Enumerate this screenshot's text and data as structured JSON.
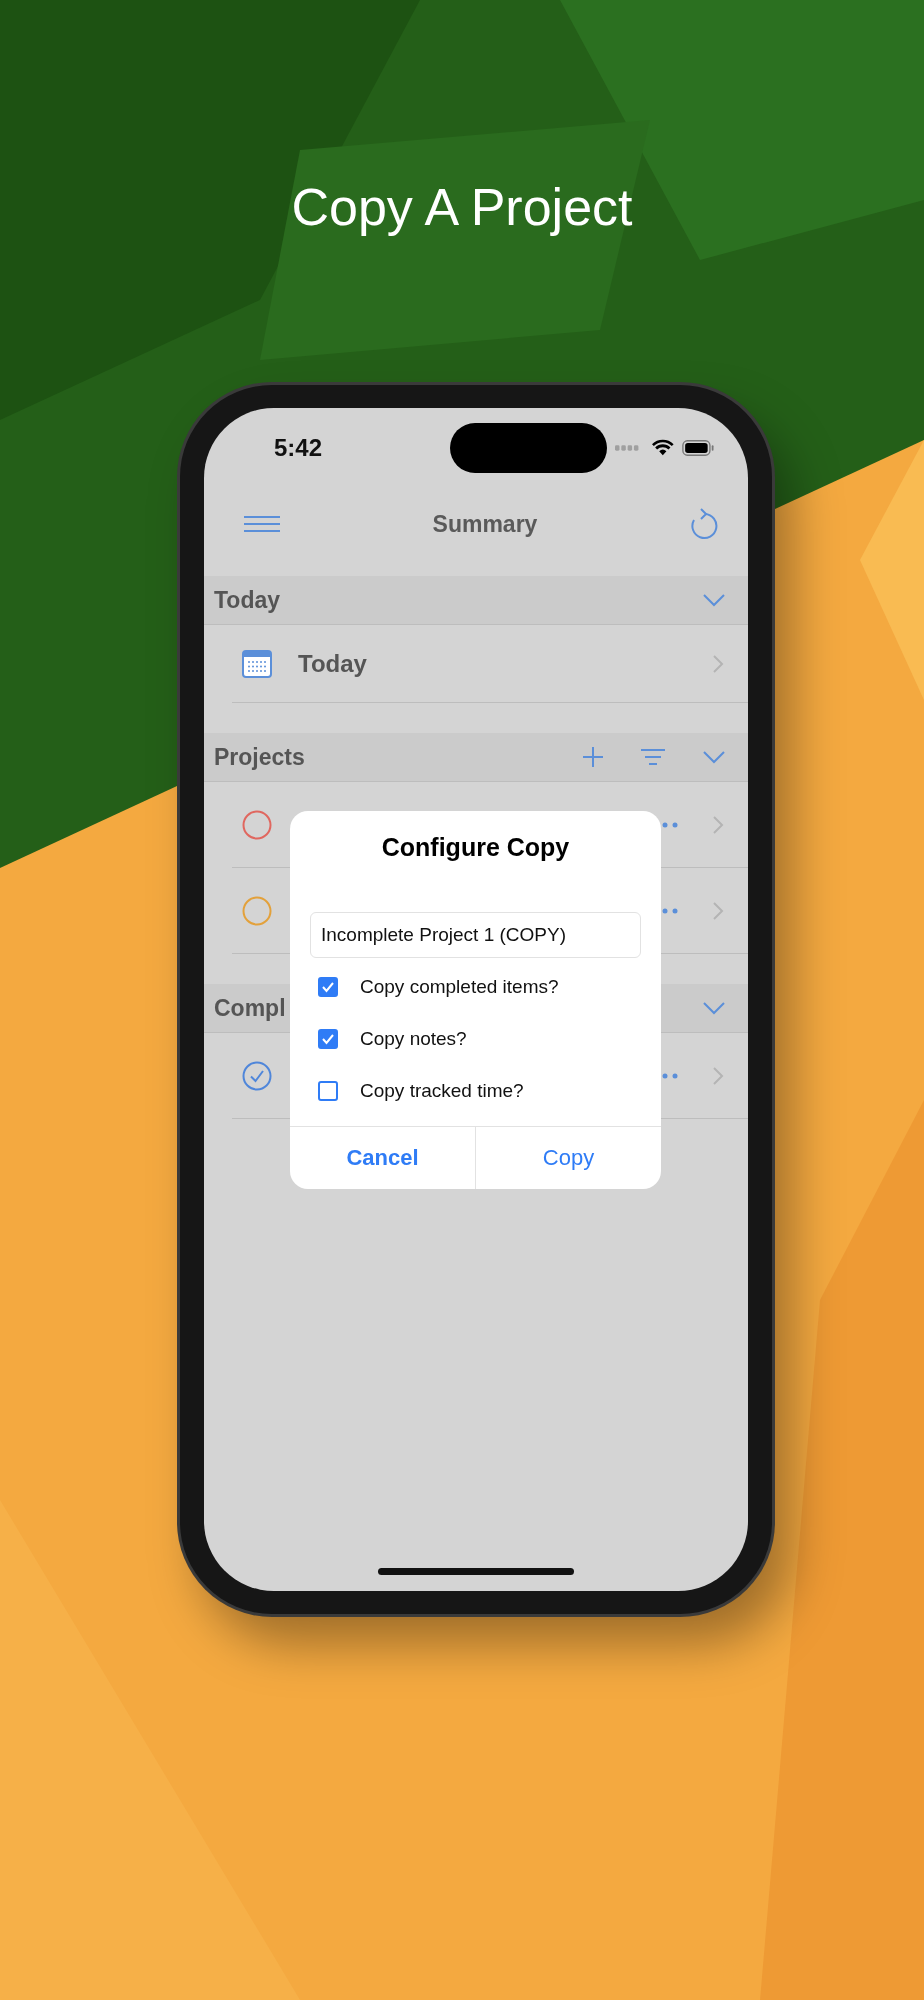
{
  "headline": "Copy A Project",
  "status_bar": {
    "time": "5:42"
  },
  "nav": {
    "title": "Summary"
  },
  "sections": [
    {
      "title": "Today",
      "add_button": false,
      "sort_button": false,
      "rows": [
        {
          "kind": "calendar",
          "label": "Today"
        }
      ]
    },
    {
      "title": "Projects",
      "add_button": true,
      "sort_button": true,
      "rows": [
        {
          "kind": "project",
          "color": "#e0675f",
          "completed": false
        },
        {
          "kind": "project",
          "color": "#e3a13b",
          "completed": false
        }
      ]
    },
    {
      "title": "Compl",
      "add_button": false,
      "sort_button": false,
      "rows": [
        {
          "kind": "project",
          "color": "#4f86da",
          "completed": true
        }
      ]
    }
  ],
  "dialog": {
    "title": "Configure Copy",
    "name_value": "Incomplete Project 1 (COPY)",
    "options": [
      {
        "label": "Copy completed items?",
        "checked": true
      },
      {
        "label": "Copy notes?",
        "checked": true
      },
      {
        "label": "Copy tracked time?",
        "checked": false
      }
    ],
    "buttons": [
      {
        "label": "Cancel",
        "kind": "cancel"
      },
      {
        "label": "Copy",
        "kind": "confirm"
      }
    ]
  }
}
